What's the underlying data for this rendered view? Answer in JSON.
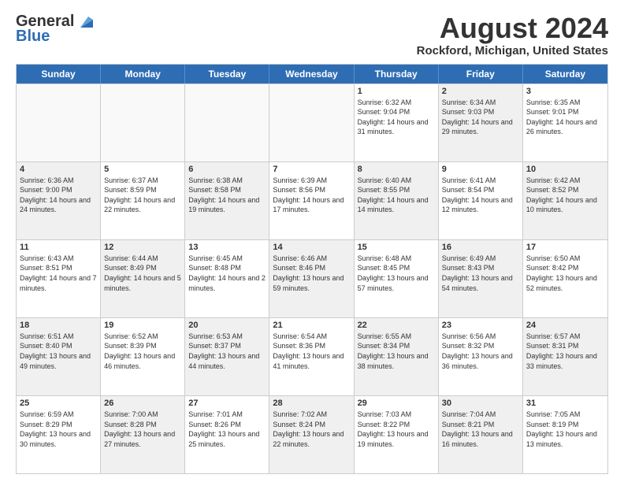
{
  "logo": {
    "line1": "General",
    "line2": "Blue"
  },
  "title": "August 2024",
  "subtitle": "Rockford, Michigan, United States",
  "header_days": [
    "Sunday",
    "Monday",
    "Tuesday",
    "Wednesday",
    "Thursday",
    "Friday",
    "Saturday"
  ],
  "weeks": [
    [
      {
        "day": "",
        "text": "",
        "empty": true
      },
      {
        "day": "",
        "text": "",
        "empty": true
      },
      {
        "day": "",
        "text": "",
        "empty": true
      },
      {
        "day": "",
        "text": "",
        "empty": true
      },
      {
        "day": "1",
        "text": "Sunrise: 6:32 AM\nSunset: 9:04 PM\nDaylight: 14 hours and 31 minutes."
      },
      {
        "day": "2",
        "text": "Sunrise: 6:34 AM\nSunset: 9:03 PM\nDaylight: 14 hours and 29 minutes.",
        "shaded": true
      },
      {
        "day": "3",
        "text": "Sunrise: 6:35 AM\nSunset: 9:01 PM\nDaylight: 14 hours and 26 minutes."
      }
    ],
    [
      {
        "day": "4",
        "text": "Sunrise: 6:36 AM\nSunset: 9:00 PM\nDaylight: 14 hours and 24 minutes.",
        "shaded": true
      },
      {
        "day": "5",
        "text": "Sunrise: 6:37 AM\nSunset: 8:59 PM\nDaylight: 14 hours and 22 minutes."
      },
      {
        "day": "6",
        "text": "Sunrise: 6:38 AM\nSunset: 8:58 PM\nDaylight: 14 hours and 19 minutes.",
        "shaded": true
      },
      {
        "day": "7",
        "text": "Sunrise: 6:39 AM\nSunset: 8:56 PM\nDaylight: 14 hours and 17 minutes."
      },
      {
        "day": "8",
        "text": "Sunrise: 6:40 AM\nSunset: 8:55 PM\nDaylight: 14 hours and 14 minutes.",
        "shaded": true
      },
      {
        "day": "9",
        "text": "Sunrise: 6:41 AM\nSunset: 8:54 PM\nDaylight: 14 hours and 12 minutes."
      },
      {
        "day": "10",
        "text": "Sunrise: 6:42 AM\nSunset: 8:52 PM\nDaylight: 14 hours and 10 minutes.",
        "shaded": true
      }
    ],
    [
      {
        "day": "11",
        "text": "Sunrise: 6:43 AM\nSunset: 8:51 PM\nDaylight: 14 hours and 7 minutes."
      },
      {
        "day": "12",
        "text": "Sunrise: 6:44 AM\nSunset: 8:49 PM\nDaylight: 14 hours and 5 minutes.",
        "shaded": true
      },
      {
        "day": "13",
        "text": "Sunrise: 6:45 AM\nSunset: 8:48 PM\nDaylight: 14 hours and 2 minutes."
      },
      {
        "day": "14",
        "text": "Sunrise: 6:46 AM\nSunset: 8:46 PM\nDaylight: 13 hours and 59 minutes.",
        "shaded": true
      },
      {
        "day": "15",
        "text": "Sunrise: 6:48 AM\nSunset: 8:45 PM\nDaylight: 13 hours and 57 minutes."
      },
      {
        "day": "16",
        "text": "Sunrise: 6:49 AM\nSunset: 8:43 PM\nDaylight: 13 hours and 54 minutes.",
        "shaded": true
      },
      {
        "day": "17",
        "text": "Sunrise: 6:50 AM\nSunset: 8:42 PM\nDaylight: 13 hours and 52 minutes."
      }
    ],
    [
      {
        "day": "18",
        "text": "Sunrise: 6:51 AM\nSunset: 8:40 PM\nDaylight: 13 hours and 49 minutes.",
        "shaded": true
      },
      {
        "day": "19",
        "text": "Sunrise: 6:52 AM\nSunset: 8:39 PM\nDaylight: 13 hours and 46 minutes."
      },
      {
        "day": "20",
        "text": "Sunrise: 6:53 AM\nSunset: 8:37 PM\nDaylight: 13 hours and 44 minutes.",
        "shaded": true
      },
      {
        "day": "21",
        "text": "Sunrise: 6:54 AM\nSunset: 8:36 PM\nDaylight: 13 hours and 41 minutes."
      },
      {
        "day": "22",
        "text": "Sunrise: 6:55 AM\nSunset: 8:34 PM\nDaylight: 13 hours and 38 minutes.",
        "shaded": true
      },
      {
        "day": "23",
        "text": "Sunrise: 6:56 AM\nSunset: 8:32 PM\nDaylight: 13 hours and 36 minutes."
      },
      {
        "day": "24",
        "text": "Sunrise: 6:57 AM\nSunset: 8:31 PM\nDaylight: 13 hours and 33 minutes.",
        "shaded": true
      }
    ],
    [
      {
        "day": "25",
        "text": "Sunrise: 6:59 AM\nSunset: 8:29 PM\nDaylight: 13 hours and 30 minutes."
      },
      {
        "day": "26",
        "text": "Sunrise: 7:00 AM\nSunset: 8:28 PM\nDaylight: 13 hours and 27 minutes.",
        "shaded": true
      },
      {
        "day": "27",
        "text": "Sunrise: 7:01 AM\nSunset: 8:26 PM\nDaylight: 13 hours and 25 minutes."
      },
      {
        "day": "28",
        "text": "Sunrise: 7:02 AM\nSunset: 8:24 PM\nDaylight: 13 hours and 22 minutes.",
        "shaded": true
      },
      {
        "day": "29",
        "text": "Sunrise: 7:03 AM\nSunset: 8:22 PM\nDaylight: 13 hours and 19 minutes."
      },
      {
        "day": "30",
        "text": "Sunrise: 7:04 AM\nSunset: 8:21 PM\nDaylight: 13 hours and 16 minutes.",
        "shaded": true
      },
      {
        "day": "31",
        "text": "Sunrise: 7:05 AM\nSunset: 8:19 PM\nDaylight: 13 hours and 13 minutes."
      }
    ]
  ]
}
